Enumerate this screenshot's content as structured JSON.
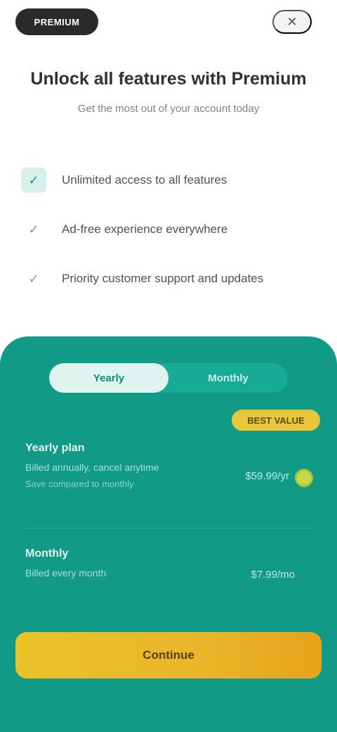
{
  "topbar": {
    "brand": "PREMIUM",
    "close_glyph": "✕"
  },
  "header": {
    "title": "Unlock all features with Premium",
    "subtitle": "Get the most out of your account today"
  },
  "features": [
    {
      "icon": "check-icon",
      "glyph": "✓",
      "label": "Unlimited access to all features"
    },
    {
      "icon": "check-icon",
      "glyph": "✓",
      "label": "Ad-free experience everywhere"
    },
    {
      "icon": "check-icon",
      "glyph": "✓",
      "label": "Priority customer support and updates"
    }
  ],
  "billing_toggle": {
    "selected": "Yearly",
    "other": "Monthly"
  },
  "badge": "BEST VALUE",
  "plans": {
    "yearly": {
      "name": "Yearly plan",
      "desc": "Billed annually, cancel anytime",
      "note": "Save compared to monthly",
      "price": "$59.99/yr"
    },
    "monthly": {
      "name": "Monthly",
      "desc": "Billed every month",
      "price": "$7.99/mo"
    }
  },
  "cta_label": "Continue",
  "colors": {
    "accent": "#119a86",
    "cta": "#e8c329"
  }
}
